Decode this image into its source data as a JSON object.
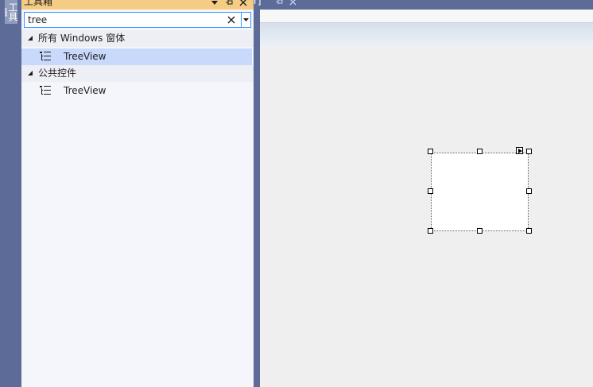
{
  "side_strip": {
    "tab_label": "工具箱"
  },
  "toolbox": {
    "title": "工具箱",
    "dropdown_icon": "chevron-down-icon",
    "pin_icon": "pin-icon",
    "close_icon": "close-icon",
    "search": {
      "value": "tree",
      "clear_icon": "close-icon"
    },
    "groups": [
      {
        "label": "所有 Windows 窗体",
        "items": [
          {
            "label": "TreeView",
            "selected": true
          }
        ]
      },
      {
        "label": "公共控件",
        "items": [
          {
            "label": "TreeView",
            "selected": false
          }
        ]
      }
    ]
  },
  "document_tab": {
    "label": "r]",
    "pin_icon": "pin-icon",
    "close_icon": "close-icon"
  },
  "colors": {
    "chrome": "#5d6b99",
    "toolbox_header": "#f5cc84",
    "selection": "#c9d9fc",
    "designer_bg": "#efefef"
  }
}
